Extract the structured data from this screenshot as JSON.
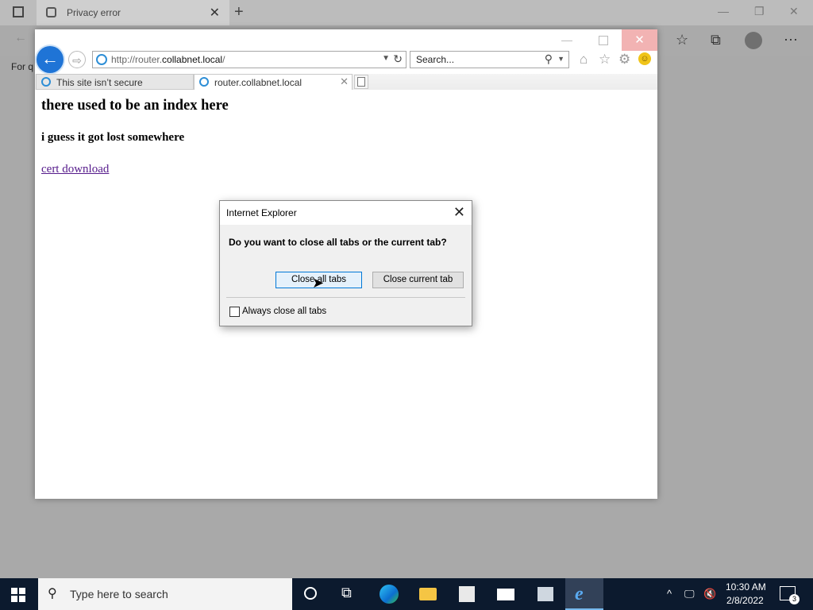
{
  "edge": {
    "tab_title": "Privacy error",
    "close_glyph": "✕",
    "new_tab_glyph": "+",
    "page_snippet": "For q",
    "icons": [
      "tab-actions-icon",
      "shield-icon",
      "new-tab-icon",
      "back-icon",
      "favorites-icon",
      "collections-icon",
      "profile-icon",
      "more-icon"
    ]
  },
  "ie": {
    "address_prefix": "http://router.",
    "address_domain": "collabnet.local",
    "address_suffix": "/",
    "search_placeholder": "Search...",
    "tabs": [
      {
        "label": "This site isn’t secure"
      },
      {
        "label": "router.collabnet.local"
      }
    ],
    "tab_close_glyph": "✕",
    "page": {
      "heading": "there used to be an index here",
      "subheading": "i guess it got lost somewhere",
      "link": "cert download"
    }
  },
  "dialog": {
    "title": "Internet Explorer",
    "question": "Do you want to close all tabs or the current tab?",
    "close_all_label": "Close all tabs",
    "close_current_label": "Close current tab",
    "checkbox_label": "Always close all tabs",
    "checkbox_checked": false
  },
  "taskbar": {
    "search_placeholder": "Type here to search",
    "time": "10:30 AM",
    "date": "2/8/2022",
    "notification_count": "3",
    "pinned": [
      "cortana-icon",
      "task-view-icon",
      "edge-icon",
      "file-explorer-icon",
      "store-icon",
      "mail-icon",
      "network-app-icon",
      "internet-explorer-icon"
    ]
  },
  "colors": {
    "accent": "#0078d7",
    "ie_back_button": "#1f74d6",
    "taskbar": "#0c1a2e",
    "link_visited": "#551a8b"
  }
}
